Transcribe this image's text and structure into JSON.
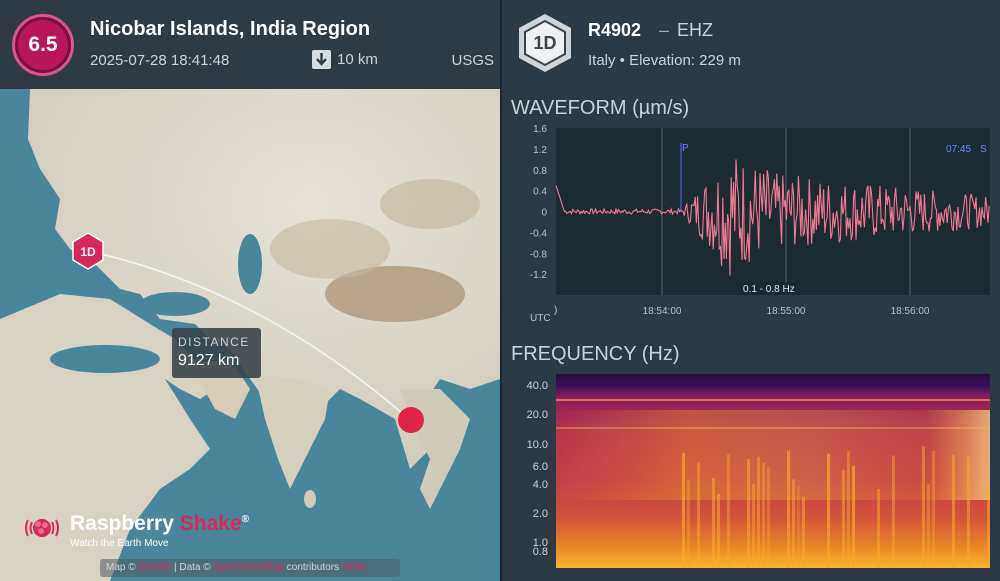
{
  "event": {
    "magnitude": "6.5",
    "title": "Nicobar Islands, India Region",
    "datetime": "2025-07-28 18:41:48",
    "depth": "10 km",
    "source": "USGS"
  },
  "map": {
    "station_marker": "1D",
    "distance_label": "DISTANCE",
    "distance_value": "9127 km",
    "logo_name_a": "Raspberry",
    "logo_name_b": "Shake",
    "logo_reg": "®",
    "logo_tagline": "Watch the Earth Move",
    "attribution_prefix": "Map ©",
    "attribution_link1": "Esri/3D",
    "attribution_mid": "| Data ©",
    "attribution_link2": "OpenStreetMap",
    "attribution_suffix": "contributors",
    "attribution_link3": "ODbL"
  },
  "station": {
    "badge": "1D",
    "id": "R4902",
    "separator": "–",
    "channel": "EHZ",
    "location": "Italy • Elevation: 229 m"
  },
  "waveform": {
    "title": "WAVEFORM (µm/s)",
    "y_ticks": [
      "1.6",
      "1.2",
      "0.8",
      "0.4",
      "0",
      "-0.4",
      "-0.8",
      "-1.2"
    ],
    "x_ticks": [
      "18:54:00",
      "18:55:00",
      "18:56:00"
    ],
    "x_left_label": "UTC",
    "x_left_tick": ")",
    "p_marker": "P",
    "s_marker_time": "07:45",
    "s_marker": "S",
    "filter_label": "0.1 - 0.8 Hz"
  },
  "frequency": {
    "title": "FREQUENCY (Hz)",
    "y_ticks": [
      "40.0",
      "20.0",
      "10.0",
      "6.0",
      "4.0",
      "2.0",
      "1.0",
      "0.8"
    ]
  },
  "colors": {
    "magnitude_badge": "#b8155a",
    "epicenter": "#e0244a",
    "waveform_trace": "#f07a92",
    "brand_shake": "#d42a5a"
  }
}
